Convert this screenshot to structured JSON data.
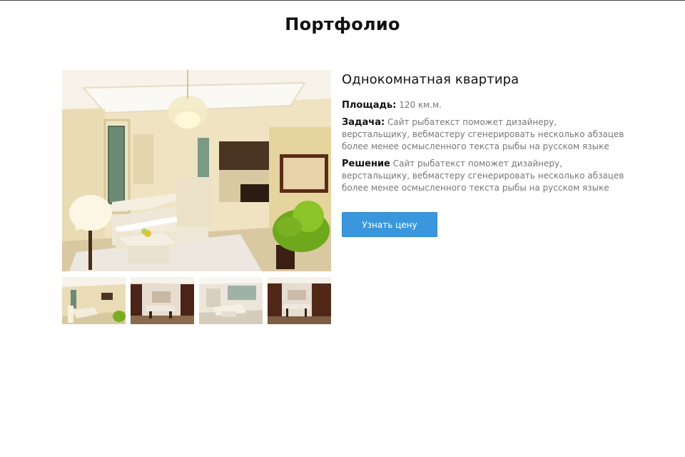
{
  "page": {
    "title": "Портфолио"
  },
  "project": {
    "title": "Однокомнатная квартира",
    "area_label": "Площадь:",
    "area_value": "120 км.м.",
    "task_label": "Задача:",
    "task_text": "Сайт рыбатекст поможет дизайнеру, верстальщику, вебмастеру сгенерировать несколько абзацев более менее осмысленного текста рыбы на русском языке",
    "solution_label": "Решение",
    "solution_text": "Сайт рыбатекст поможет дизайнеру, верстальщику, вебмастеру сгенерировать несколько абзацев более менее осмысленного текста рыбы на русском языке",
    "cta_label": "Узнать цену"
  },
  "colors": {
    "accent": "#3a97dd",
    "label": "#111111",
    "muted": "#777777"
  },
  "gallery": {
    "main_image": "living-room-photo",
    "thumbnails": [
      "living-room-thumb",
      "dining-room-thumb",
      "kitchen-living-thumb",
      "dining-hall-thumb"
    ]
  }
}
